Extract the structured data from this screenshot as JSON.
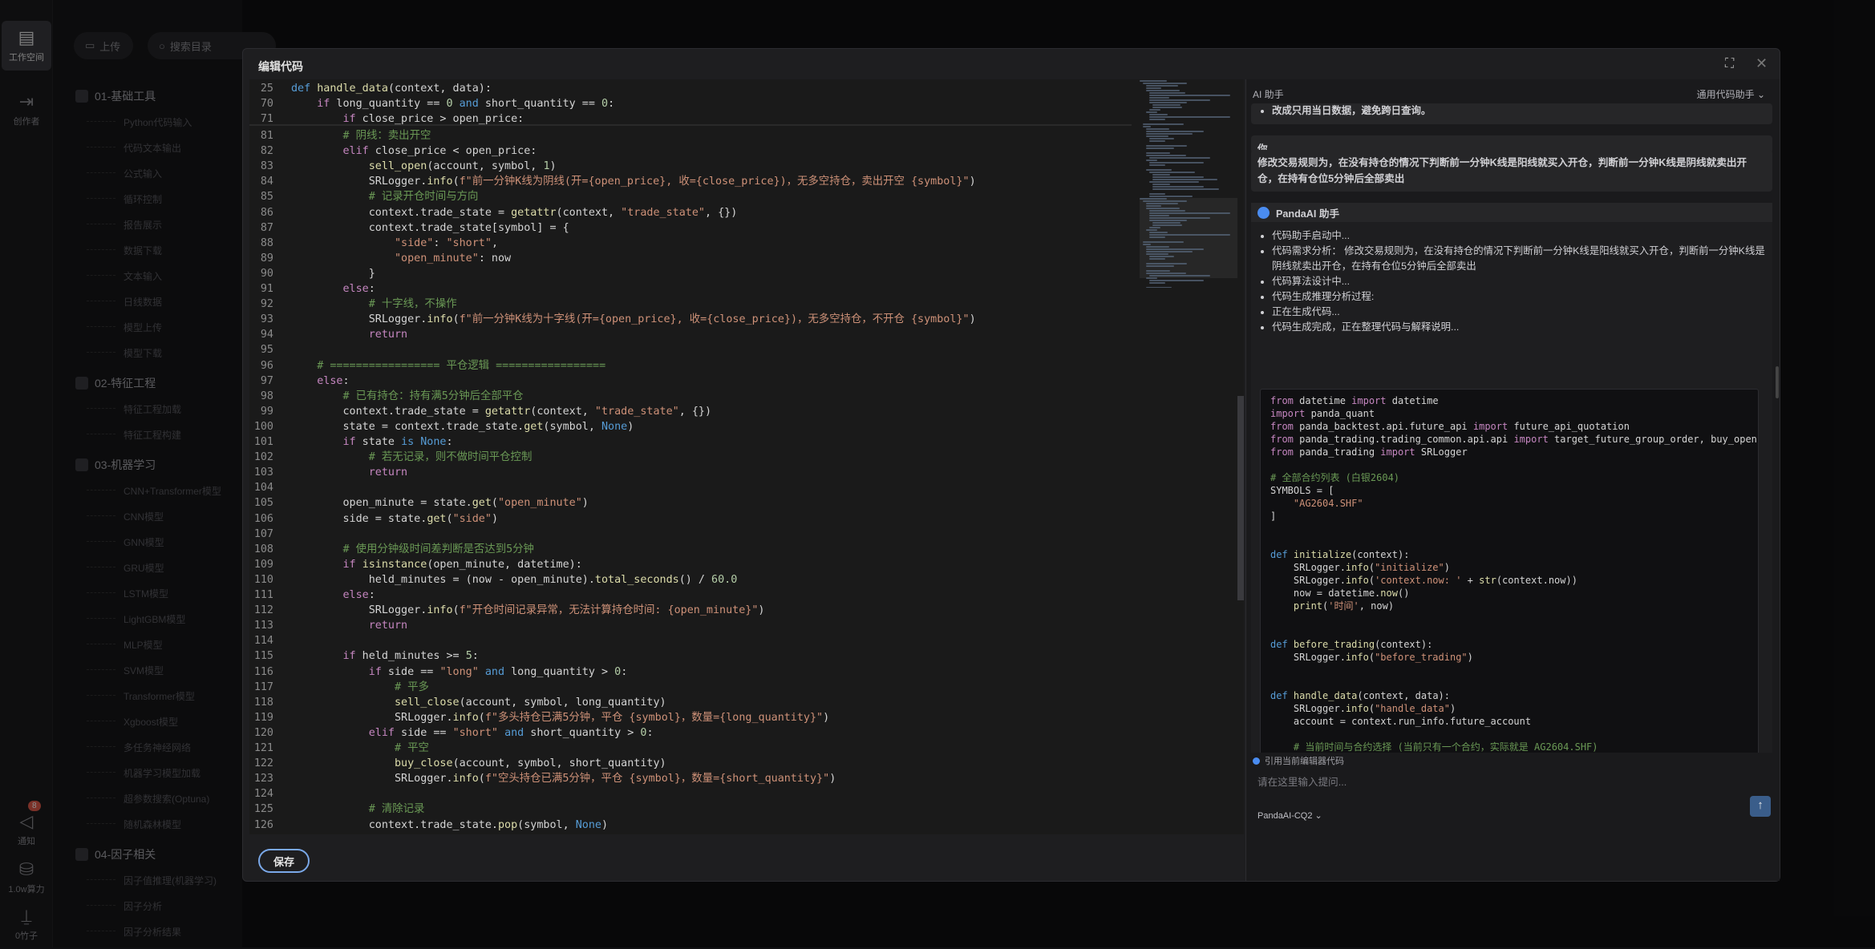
{
  "nav": {
    "workspace": "工作空间",
    "creator": "创作者",
    "notify": "通知",
    "notify_badge": "8",
    "power": "1.0w算力",
    "coins": "0竹子"
  },
  "sidebar": {
    "upload": "上传",
    "search_placeholder": "搜索目录",
    "groups": [
      {
        "title": "01-基础工具",
        "items": [
          "Python代码输入",
          "代码文本输出",
          "公式输入",
          "循环控制",
          "报告展示",
          "数据下载",
          "文本输入",
          "日线数据",
          "模型上传",
          "模型下载"
        ]
      },
      {
        "title": "02-特征工程",
        "items": [
          "特征工程加载",
          "特征工程构建"
        ]
      },
      {
        "title": "03-机器学习",
        "items": [
          "CNN+Transformer模型",
          "CNN模型",
          "GNN模型",
          "GRU模型",
          "LSTM模型",
          "LightGBM模型",
          "MLP模型",
          "SVM模型",
          "Transformer模型",
          "Xgboost模型",
          "多任务神经网络",
          "机器学习模型加载",
          "超参数搜索(Optuna)",
          "随机森林模型"
        ]
      },
      {
        "title": "04-因子相关",
        "items": [
          "因子值推理(机器学习)",
          "因子分析",
          "因子分析结果"
        ]
      }
    ]
  },
  "modal": {
    "title": "编辑代码",
    "save": "保存"
  },
  "editor": {
    "lines": [
      [
        "25",
        "def handle_data(context, data):"
      ],
      [
        "70",
        "    if long_quantity == 0 and short_quantity == 0:"
      ],
      [
        "71",
        "        if close_price > open_price:"
      ],
      [
        "81",
        "        # 阴线：卖出开空"
      ],
      [
        "82",
        "        elif close_price < open_price:"
      ],
      [
        "83",
        "            sell_open(account, symbol, 1)"
      ],
      [
        "84",
        "            SRLogger.info(f\"前一分钟K线为阴线(开={open_price}, 收={close_price})，无多空持仓，卖出开空 {symbol}\")"
      ],
      [
        "85",
        "            # 记录开仓时间与方向"
      ],
      [
        "86",
        "            context.trade_state = getattr(context, \"trade_state\", {})"
      ],
      [
        "87",
        "            context.trade_state[symbol] = {"
      ],
      [
        "88",
        "                \"side\": \"short\","
      ],
      [
        "89",
        "                \"open_minute\": now"
      ],
      [
        "90",
        "            }"
      ],
      [
        "91",
        "        else:"
      ],
      [
        "92",
        "            # 十字线，不操作"
      ],
      [
        "93",
        "            SRLogger.info(f\"前一分钟K线为十字线(开={open_price}, 收={close_price})，无多空持仓，不开仓 {symbol}\")"
      ],
      [
        "94",
        "            return"
      ],
      [
        "95",
        ""
      ],
      [
        "96",
        "    # ================= 平仓逻辑 ================="
      ],
      [
        "97",
        "    else:"
      ],
      [
        "98",
        "        # 已有持仓：持有满5分钟后全部平仓"
      ],
      [
        "99",
        "        context.trade_state = getattr(context, \"trade_state\", {})"
      ],
      [
        "100",
        "        state = context.trade_state.get(symbol, None)"
      ],
      [
        "101",
        "        if state is None:"
      ],
      [
        "102",
        "            # 若无记录，则不做时间平仓控制"
      ],
      [
        "103",
        "            return"
      ],
      [
        "104",
        ""
      ],
      [
        "105",
        "        open_minute = state.get(\"open_minute\")"
      ],
      [
        "106",
        "        side = state.get(\"side\")"
      ],
      [
        "107",
        ""
      ],
      [
        "108",
        "        # 使用分钟级时间差判断是否达到5分钟"
      ],
      [
        "109",
        "        if isinstance(open_minute, datetime):"
      ],
      [
        "110",
        "            held_minutes = (now - open_minute).total_seconds() / 60.0"
      ],
      [
        "111",
        "        else:"
      ],
      [
        "112",
        "            SRLogger.info(f\"开仓时间记录异常，无法计算持仓时间: {open_minute}\")"
      ],
      [
        "113",
        "            return"
      ],
      [
        "114",
        ""
      ],
      [
        "115",
        "        if held_minutes >= 5:"
      ],
      [
        "116",
        "            if side == \"long\" and long_quantity > 0:"
      ],
      [
        "117",
        "                # 平多"
      ],
      [
        "118",
        "                sell_close(account, symbol, long_quantity)"
      ],
      [
        "119",
        "                SRLogger.info(f\"多头持仓已满5分钟，平仓 {symbol}，数量={long_quantity}\")"
      ],
      [
        "120",
        "            elif side == \"short\" and short_quantity > 0:"
      ],
      [
        "121",
        "                # 平空"
      ],
      [
        "122",
        "                buy_close(account, symbol, short_quantity)"
      ],
      [
        "123",
        "                SRLogger.info(f\"空头持仓已满5分钟，平仓 {symbol}，数量={short_quantity}\")"
      ],
      [
        "124",
        ""
      ],
      [
        "125",
        "            # 清除记录"
      ],
      [
        "126",
        "            context.trade_state.pop(symbol, None)"
      ]
    ]
  },
  "ai": {
    "header": "AI 助手",
    "mode": "通用代码助手",
    "prev_tail": "改成只用当日数据，避免跨日查询。",
    "user_label": "你",
    "user_text": "修改交易规则为，在没有持仓的情况下判断前一分钟K线是阳线就买入开仓，判断前一分钟K线是阴线就卖出开仓，在持有仓位5分钟后全部卖出",
    "bot_label": "PandaAI 助手",
    "steps": [
      "代码助手启动中...",
      "代码需求分析：  修改交易规则为，在没有持仓的情况下判断前一分钟K线是阳线就买入开仓，判断前一分钟K线是阴线就卖出开仓，在持有仓位5分钟后全部卖出",
      "代码算法设计中...",
      "代码生成推理分析过程:",
      "正在生成代码...",
      "代码生成完成，正在整理代码与解释说明..."
    ],
    "code": [
      "from datetime import datetime",
      "import panda_quant",
      "from panda_backtest.api.future_api import future_api_quotation",
      "from panda_trading.trading_common.api.api import target_future_group_order, buy_open, sell_o",
      "from panda_trading import SRLogger",
      "",
      "# 全部合约列表 (白银2604)",
      "SYMBOLS = [",
      "    \"AG2604.SHF\"",
      "]",
      "",
      "",
      "def initialize(context):",
      "    SRLogger.info(\"initialize\")",
      "    SRLogger.info('context.now: ' + str(context.now))",
      "    now = datetime.now()",
      "    print('时间', now)",
      "",
      "",
      "def before_trading(context):",
      "    SRLogger.info(\"before_trading\")",
      "",
      "",
      "def handle_data(context, data):",
      "    SRLogger.info(\"handle_data\")",
      "    account = context.run_info.future_account",
      "",
      "    # 当前时间与合约选择 (当前只有一个合约，实际就是 AG2604.SHF)"
    ],
    "ref": "引用当前编辑器代码",
    "placeholder": "请在这里输入提问...",
    "model": "PandaAI-CQ2"
  },
  "colors": {
    "accent": "#7aa8e8",
    "badge": "#e05a4a",
    "keyword": "#569cd6",
    "string": "#ce9178",
    "comment": "#6a9955",
    "func": "#dcdcaa"
  }
}
